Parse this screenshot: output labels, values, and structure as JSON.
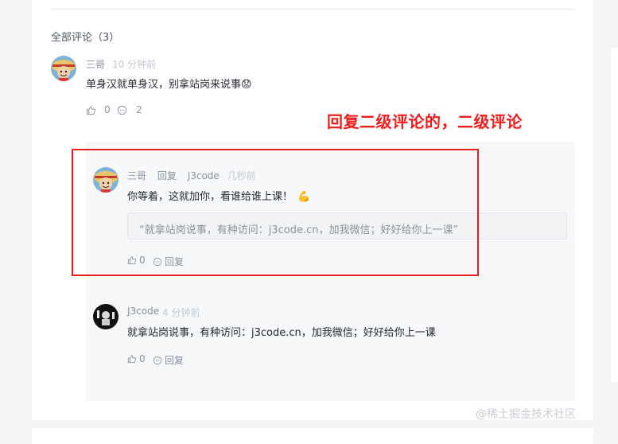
{
  "section": {
    "title": "全部评论（3）"
  },
  "comment": {
    "author": "三哥",
    "time": "10 分钟前",
    "text": "单身汉就单身汉，别拿站岗来说事",
    "emoji": "😟",
    "likes": "0",
    "replies": "2"
  },
  "reply1": {
    "author": "三哥",
    "reply_word": "回复",
    "target": "J3code",
    "time": "几秒前",
    "text": "你等着，这就加你，看谁给谁上课！",
    "emoji": "💪",
    "quote": "“就拿站岗说事，有种访问：j3code.cn，加我微信；好好给你上一课”",
    "likes": "0",
    "reply_label": "回复"
  },
  "reply2": {
    "author": "J3code",
    "time": "4 分钟前",
    "text": "就拿站岗说事，有种访问：j3code.cn，加我微信；好好给你上一课",
    "likes": "0",
    "reply_label": "回复"
  },
  "annotation": {
    "text": "回复二级评论的，二级评论",
    "color": "#f21b1b"
  },
  "watermark": {
    "text": "@稀土掘金技术社区"
  }
}
